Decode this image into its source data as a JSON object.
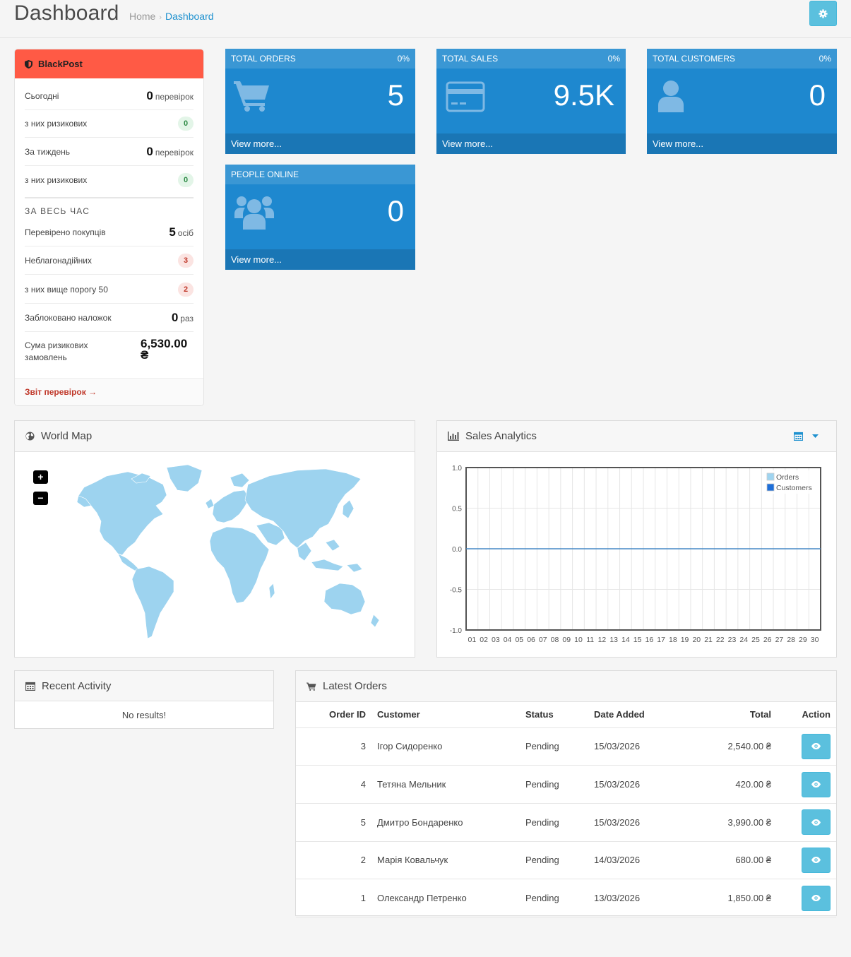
{
  "header": {
    "title": "Dashboard",
    "breadcrumb": [
      "Home",
      "Dashboard"
    ],
    "breadcrumb_sep": "›"
  },
  "blackpost": {
    "title": "BlackPost",
    "rows": [
      {
        "label": "Сьогодні",
        "value": "0",
        "unit": "перевірок"
      },
      {
        "label": "з них ризикових",
        "badge": "0"
      },
      {
        "label": "За тиждень",
        "value": "0",
        "unit": "перевірок"
      },
      {
        "label": "з них ризикових",
        "badge": "0"
      }
    ],
    "section_title": "ЗА ВЕСЬ ЧАС",
    "all_time": [
      {
        "label": "Перевірено покупців",
        "value": "5",
        "unit": "осіб"
      },
      {
        "label": "Неблагонадійних",
        "badge": "3"
      },
      {
        "label": "з них вище порогу 50",
        "badge": "2"
      },
      {
        "label": "Заблоковано наложок",
        "value": "0",
        "unit": "раз"
      },
      {
        "label": "Сума ризикових замовлень",
        "value": "6,530.00",
        "unit": "₴"
      }
    ],
    "footer_link": "Звіт перевірок →",
    "colors": {
      "header": "#ff5a45",
      "link": "#c0392b"
    }
  },
  "tiles": [
    {
      "title": "TOTAL ORDERS",
      "percent": "0%",
      "value": "5",
      "footer": "View more...",
      "icon": "shopping-cart-icon"
    },
    {
      "title": "TOTAL SALES",
      "percent": "0%",
      "value": "9.5K",
      "footer": "View more...",
      "icon": "credit-card-icon"
    },
    {
      "title": "TOTAL CUSTOMERS",
      "percent": "0%",
      "value": "0",
      "footer": "View more...",
      "icon": "user-icon"
    },
    {
      "title": "PEOPLE ONLINE",
      "value": "0",
      "footer": "View more...",
      "icon": "users-icon"
    }
  ],
  "world_map": {
    "title": "World Map",
    "zoom_in": "+",
    "zoom_out": "−",
    "land_color": "#9dd3ef"
  },
  "sales_analytics": {
    "title": "Sales Analytics"
  },
  "chart_data": {
    "type": "line",
    "x": [
      "01",
      "02",
      "03",
      "04",
      "05",
      "06",
      "07",
      "08",
      "09",
      "10",
      "11",
      "12",
      "13",
      "14",
      "15",
      "16",
      "17",
      "18",
      "19",
      "20",
      "21",
      "22",
      "23",
      "24",
      "25",
      "26",
      "27",
      "28",
      "29",
      "30"
    ],
    "series": [
      {
        "name": "Orders",
        "values": [
          0,
          0,
          0,
          0,
          0,
          0,
          0,
          0,
          0,
          0,
          0,
          0,
          0,
          0,
          0,
          0,
          0,
          0,
          0,
          0,
          0,
          0,
          0,
          0,
          0,
          0,
          0,
          0,
          0,
          0
        ],
        "color": "#9fd4f0"
      },
      {
        "name": "Customers",
        "values": [
          0,
          0,
          0,
          0,
          0,
          0,
          0,
          0,
          0,
          0,
          0,
          0,
          0,
          0,
          0,
          0,
          0,
          0,
          0,
          0,
          0,
          0,
          0,
          0,
          0,
          0,
          0,
          0,
          0,
          0
        ],
        "color": "#1e6fd9"
      }
    ],
    "yticks": [
      "1.0",
      "0.5",
      "0.0",
      "-0.5",
      "-1.0"
    ],
    "ylim": [
      -1,
      1
    ],
    "grid": true,
    "legend": "top-right"
  },
  "recent_activity": {
    "title": "Recent Activity",
    "empty": "No results!"
  },
  "latest_orders": {
    "title": "Latest Orders",
    "columns": [
      "Order ID",
      "Customer",
      "Status",
      "Date Added",
      "Total",
      "Action"
    ],
    "rows": [
      {
        "id": "3",
        "customer": "Ігор Сидоренко",
        "status": "Pending",
        "date": "15/03/2026",
        "total": "2,540.00 ₴"
      },
      {
        "id": "4",
        "customer": "Тетяна Мельник",
        "status": "Pending",
        "date": "15/03/2026",
        "total": "420.00 ₴"
      },
      {
        "id": "5",
        "customer": "Дмитро Бондаренко",
        "status": "Pending",
        "date": "15/03/2026",
        "total": "3,990.00 ₴"
      },
      {
        "id": "2",
        "customer": "Марія Ковальчук",
        "status": "Pending",
        "date": "14/03/2026",
        "total": "680.00 ₴"
      },
      {
        "id": "1",
        "customer": "Олександр Петренко",
        "status": "Pending",
        "date": "13/03/2026",
        "total": "1,850.00 ₴"
      }
    ]
  },
  "colors": {
    "tile": "#1e88cf",
    "tile_head": "#3a97d4",
    "tile_foot": "#1a76b5",
    "info_button": "#5bc0de",
    "breadcrumb_active": "#1e91cf"
  }
}
